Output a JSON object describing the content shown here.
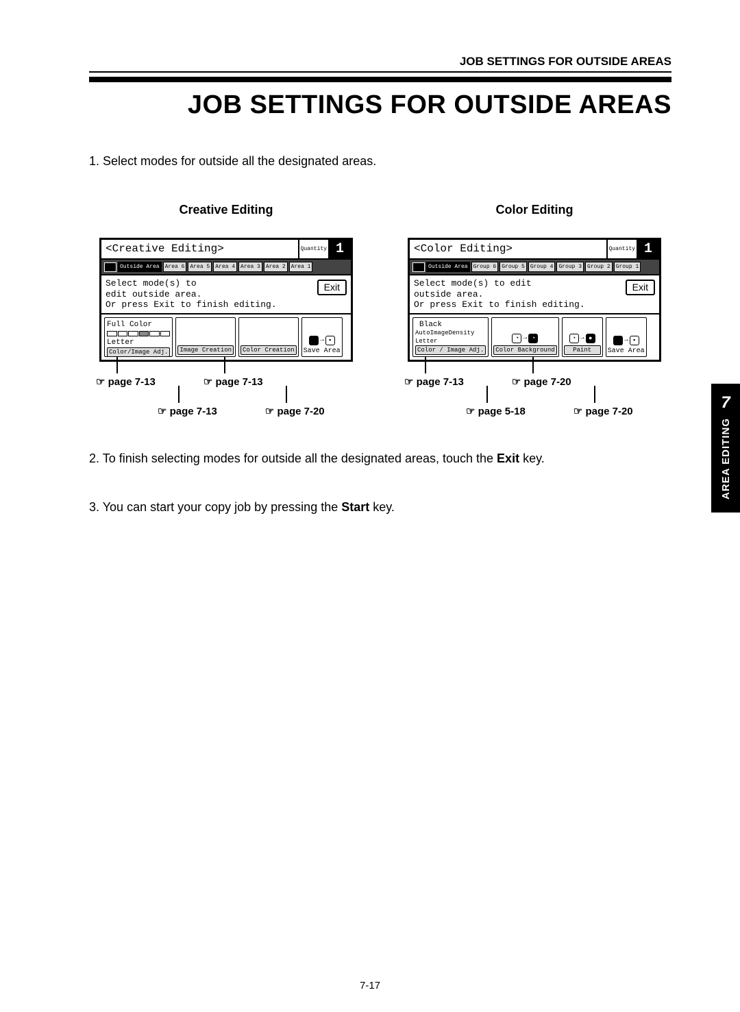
{
  "header": "JOB SETTINGS FOR OUTSIDE AREAS",
  "title": "JOB SETTINGS FOR OUTSIDE AREAS",
  "step1": "1. Select modes for outside all the designated areas.",
  "step2_pre": "2. To finish selecting modes for outside all the designated areas, touch the ",
  "step2_bold": "Exit",
  "step2_post": " key.",
  "step3_pre": "3. You can start your copy job by pressing the ",
  "step3_bold": "Start",
  "step3_post": " key.",
  "creative": {
    "label": "Creative Editing",
    "screen_title": "<Creative Editing>",
    "qty_label": "Quantity",
    "qty": "1",
    "tabs": {
      "outside": "Outside Area",
      "a6": "Area 6",
      "a5": "Area 5",
      "a4": "Area 4",
      "a3": "Area 3",
      "a2": "Area 2",
      "a1": "Area 1"
    },
    "instr": "Select mode(s) to\nedit outside area.\nOr press  Exit  to finish editing.",
    "exit": "Exit",
    "main_top": "Full Color",
    "main_mid": "Letter",
    "main_bottom": "Color/Image Adj.",
    "btn2": "Image Creation",
    "btn3": "Color Creation",
    "save": "Save Area",
    "refs": {
      "r1": "☞ page 7-13",
      "r2": "☞ page 7-13",
      "r3": "☞ page 7-13",
      "r4": "☞ page 7-20"
    }
  },
  "color": {
    "label": "Color Editing",
    "screen_title": "<Color Editing>",
    "qty_label": "Quantity",
    "qty": "1",
    "tabs": {
      "outside": "Outside Area",
      "g6": "Group 6",
      "g5": "Group 5",
      "g4": "Group 4",
      "g3": "Group 3",
      "g2": "Group 2",
      "g1": "Group 1"
    },
    "instr": "Select mode(s) to edit\noutside area.\nOr press  Exit  to finish editing.",
    "exit": "Exit",
    "main_top": "Black",
    "main_mid": "AutoImageDensity\nLetter",
    "main_bottom": "Color / Image Adj.",
    "btn2": "Color Background",
    "btn3": "Paint",
    "save": "Save Area",
    "refs": {
      "r1": "☞ page 7-13",
      "r2": "☞ page 7-20",
      "r3": "☞ page 5-18",
      "r4": "☞ page 7-20"
    }
  },
  "sidetab": {
    "num": "7",
    "txt": "AREA EDITING"
  },
  "pagenum": "7-17"
}
